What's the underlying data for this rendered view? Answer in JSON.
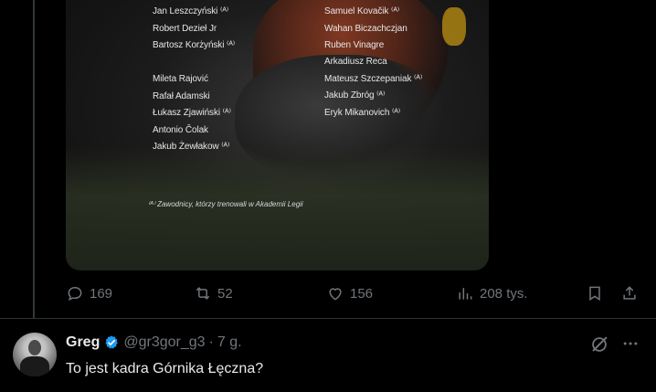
{
  "media": {
    "col1_top": [
      "Jan Leszczyński ⁽ᴬ⁾",
      "Robert Dezieł Jr",
      "Bartosz Korżyński ⁽ᴬ⁾"
    ],
    "col1_bottom": [
      "Mileta Rajović",
      "Rafał Adamski",
      "Łukasz Zjawiński ⁽ᴬ⁾",
      "Antonio Čolak",
      "Jakub Żewłakow ⁽ᴬ⁾"
    ],
    "col2_top": [
      "Samuel Kovačik ⁽ᴬ⁾",
      "Wahan Biczachczjan",
      "Ruben Vinagre"
    ],
    "col2_bottom": [
      "Arkadiusz Reca",
      "Mateusz Szczepaniak ⁽ᴬ⁾",
      "Jakub Zbróg ⁽ᴬ⁾",
      "Eryk Mikanovich ⁽ᴬ⁾"
    ],
    "footnote": "⁽ᴬ⁾ Zawodnicy, którzy trenowali w Akademii Legii"
  },
  "actions": {
    "replies": "169",
    "reposts": "52",
    "likes": "156",
    "views": "208 tys."
  },
  "icons": {
    "reply": "speech-bubble-icon",
    "repost": "repost-icon",
    "like": "heart-icon",
    "views": "bar-chart-icon",
    "bookmark": "bookmark-icon",
    "share": "share-icon",
    "verified": "verified-badge-icon",
    "grok": "grok-icon",
    "more": "more-dots-icon"
  },
  "colors": {
    "background": "#000000",
    "muted": "#71767b",
    "verified": "#1d9bf0",
    "text": "#e7e9ea"
  },
  "reply": {
    "name": "Greg",
    "handle": "@gr3gor_g3",
    "separator": "·",
    "time": "7 g.",
    "text": "To jest kadra Górnika Łęczna?"
  }
}
